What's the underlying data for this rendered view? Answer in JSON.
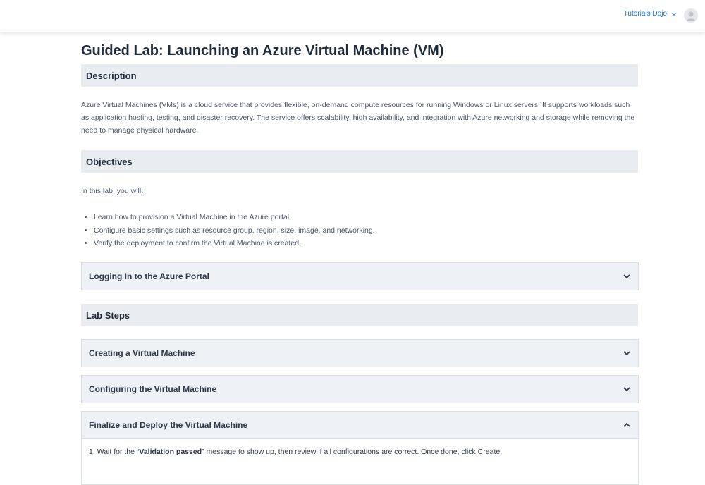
{
  "header": {
    "user_name": "Tutorials Dojo"
  },
  "page": {
    "title": "Guided Lab: Launching an Azure Virtual Machine (VM)"
  },
  "description": {
    "heading": "Description",
    "text": "Azure Virtual Machines (VMs) is a cloud service that provides flexible, on-demand compute resources for running Windows or Linux servers. It supports workloads such as application hosting, testing, and disaster recovery. The service offers scalability, high availability, and integration with Azure networking and storage while removing the need to manage physical hardware."
  },
  "objectives": {
    "heading": "Objectives",
    "intro": "In this lab, you will:",
    "items": [
      "Learn how to provision a Virtual Machine in the Azure portal.",
      "Configure basic settings such as resource group, region, size, image, and networking.",
      "Verify the deployment to confirm the Virtual Machine is created."
    ]
  },
  "logging_in": {
    "label": "Logging In to the Azure Portal"
  },
  "lab_steps": {
    "heading": "Lab Steps",
    "accordions": [
      {
        "label": "Creating a Virtual Machine"
      },
      {
        "label": "Configuring the Virtual Machine"
      },
      {
        "label": "Finalize and Deploy the Virtual Machine"
      }
    ],
    "step1": {
      "prefix": "1. Wait for the “",
      "bold": "Validation passed",
      "suffix": "” message to show up, then review if all configurations are correct. Once done, click Create."
    }
  }
}
